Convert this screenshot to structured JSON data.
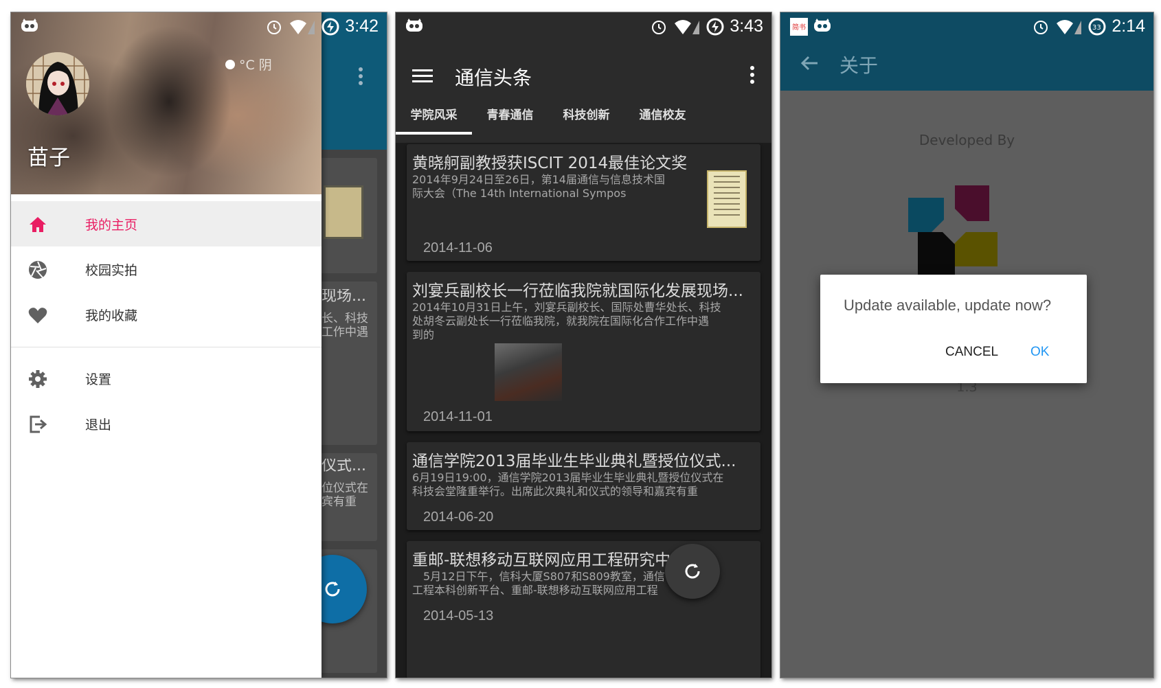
{
  "colors": {
    "accent_pink": "#e91e63",
    "appbar_blue": "#0e5a78",
    "dark_appbar": "#2b2b2b",
    "dialog_ok_blue": "#2196f3"
  },
  "screen1": {
    "status_time": "3:42",
    "weather": "°C  阴",
    "username": "苗子",
    "menu": [
      {
        "label": "我的主页",
        "icon": "home-icon",
        "active": true
      },
      {
        "label": "校园实拍",
        "icon": "camera-aperture-icon",
        "active": false
      },
      {
        "label": "我的收藏",
        "icon": "heart-icon",
        "active": false
      },
      {
        "label": "设置",
        "icon": "gear-icon",
        "active": false
      },
      {
        "label": "退出",
        "icon": "logout-icon",
        "active": false
      }
    ],
    "bg_text": {
      "title2": "现场...",
      "sum2a": "长、科技",
      "sum2b": "工作中遇",
      "title3": "仪式...",
      "sum3a": "位仪式在",
      "sum3b": "宾有重"
    }
  },
  "screen2": {
    "status_time": "3:43",
    "title": "通信头条",
    "tabs": [
      "学院风采",
      "青春通信",
      "科技创新",
      "通信校友"
    ],
    "active_tab": 0,
    "news": [
      {
        "title": "黄晓舸副教授获ISCIT 2014最佳论文奖",
        "summary_line1": "2014年9月24日至26日，第14届通信与信息技术国",
        "summary_line2": "际大会（The 14th International Sympos",
        "summary_line3": "",
        "date": "2014-11-06",
        "thumb": "certificate"
      },
      {
        "title": "刘宴兵副校长一行莅临我院就国际化发展现场...",
        "summary_line1": "2014年10月31日上午，刘宴兵副校长、国际处曹华处长、科技",
        "summary_line2": "处胡冬云副处长一行莅临我院，就我院在国际化合作工作中遇",
        "summary_line3": "到的",
        "date": "2014-11-01",
        "thumb": "meeting-photo"
      },
      {
        "title": "通信学院2013届毕业生毕业典礼暨授位仪式...",
        "summary_line1": "6月19日19:00，通信学院2013届毕业生毕业典礼暨授位仪式在",
        "summary_line2": "科技会堂隆重举行。出席此次典礼和仪式的领导和嘉宾有重",
        "summary_line3": "",
        "date": "2014-06-20",
        "thumb": ""
      },
      {
        "title": "重邮-联想移动互联网应用工程研究中心",
        "summary_line1": "　5月12日下午，信科大厦S807和S809教室，通信",
        "summary_line2": "工程本科创新平台、重邮-联想移动互联网应用工程",
        "summary_line3": "",
        "date": "2014-05-13",
        "thumb": ""
      }
    ]
  },
  "screen3": {
    "status_time": "2:14",
    "title": "关于",
    "developed_by": "Developed By",
    "version": "1.3",
    "dialog": {
      "message": "Update available, update now?",
      "cancel": "CANCEL",
      "ok": "OK"
    }
  }
}
